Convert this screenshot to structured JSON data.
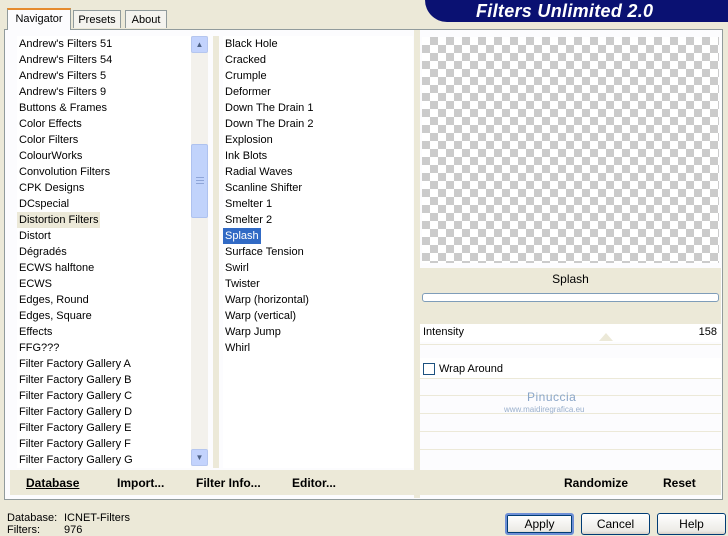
{
  "tabs": [
    "Navigator",
    "Presets",
    "About"
  ],
  "app_title": "Filters Unlimited 2.0",
  "categories": [
    "Andrew's Filters 51",
    "Andrew's Filters 54",
    "Andrew's Filters 5",
    "Andrew's Filters 9",
    "Buttons & Frames",
    "Color Effects",
    "Color Filters",
    "ColourWorks",
    "Convolution Filters",
    "CPK Designs",
    "DCspecial",
    "Distortion Filters",
    "Distort",
    "Dégradés",
    "ECWS halftone",
    "ECWS",
    "Edges, Round",
    "Edges, Square",
    "Effects",
    "FFG???",
    "Filter Factory Gallery A",
    "Filter Factory Gallery B",
    "Filter Factory Gallery C",
    "Filter Factory Gallery D",
    "Filter Factory Gallery E",
    "Filter Factory Gallery F",
    "Filter Factory Gallery G"
  ],
  "selected_category_index": 11,
  "filters": [
    "Black Hole",
    "Cracked",
    "Crumple",
    "Deformer",
    "Down The Drain 1",
    "Down The Drain 2",
    "Explosion",
    "Ink Blots",
    "Radial Waves",
    "Scanline Shifter",
    "Smelter 1",
    "Smelter 2",
    "Splash",
    "Surface Tension",
    "Swirl",
    "Twister",
    "Warp (horizontal)",
    "Warp (vertical)",
    "Warp Jump",
    "Whirl"
  ],
  "selected_filter_index": 12,
  "preview": {
    "filter_name": "Splash",
    "param_label": "Intensity",
    "param_value": "158",
    "checkbox_label": "Wrap Around",
    "checkbox_checked": false
  },
  "watermark": {
    "name": "Pinuccia",
    "url": "www.maidiregrafica.eu"
  },
  "left_buttons": {
    "database": "Database",
    "import": "Import...",
    "filter_info": "Filter Info...",
    "editor": "Editor..."
  },
  "right_buttons": {
    "randomize": "Randomize",
    "reset": "Reset"
  },
  "status": {
    "database_label": "Database:",
    "database_value": "ICNET-Filters",
    "filters_label": "Filters:",
    "filters_value": "976"
  },
  "dialog_buttons": {
    "apply": "Apply",
    "cancel": "Cancel",
    "help": "Help"
  }
}
